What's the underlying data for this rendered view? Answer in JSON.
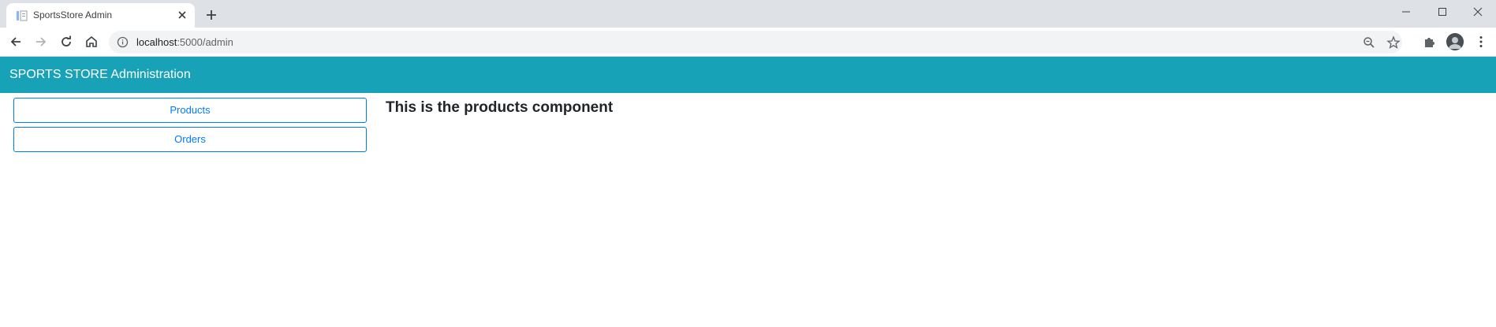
{
  "browser": {
    "tab": {
      "title": "SportsStore Admin"
    },
    "address": {
      "host": "localhost",
      "port_path": ":5000/admin"
    }
  },
  "app": {
    "brand": "SPORTS STORE Administration",
    "sidebar": {
      "items": [
        {
          "label": "Products"
        },
        {
          "label": "Orders"
        }
      ]
    },
    "content": {
      "heading": "This is the products component"
    },
    "colors": {
      "navbar": "#17a2b8",
      "button_outline": "#007bff"
    }
  }
}
